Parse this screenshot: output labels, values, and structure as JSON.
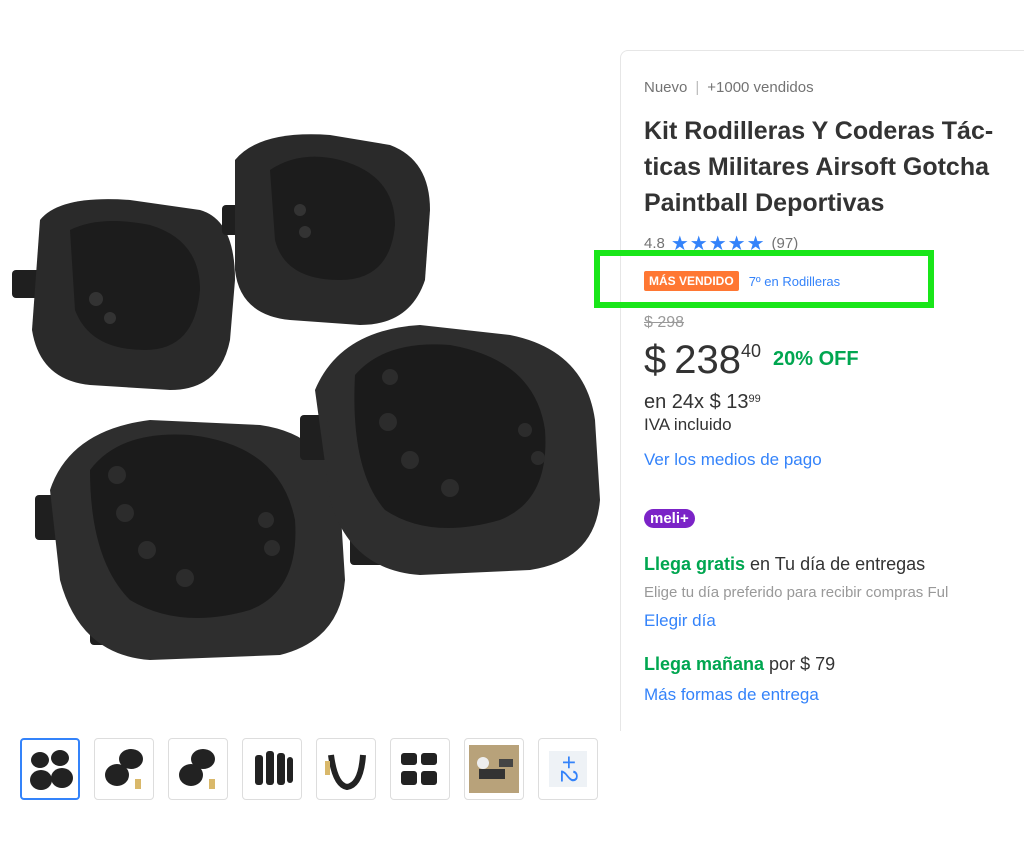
{
  "product": {
    "condition": "Nuevo",
    "sold": "+1000 vendidos",
    "title_line1": "Kit Rodilleras Y Coderas Tác-",
    "title_line2": "ticas Militares Airsoft Gotcha",
    "title_line3": "Paintball Deportivas",
    "rating": "4.8",
    "stars": "★★★★★",
    "reviews": "(97)",
    "badge": "MÁS VENDIDO",
    "rank": "7º en Rodilleras"
  },
  "price": {
    "old": "$ 298",
    "currency": "$",
    "integer": "238",
    "cents": "40",
    "discount": "20% OFF",
    "installments_prefix": "en 24x $ 13",
    "installments_cents": "99",
    "tax": "IVA incluido",
    "payment_link": "Ver los medios de pago"
  },
  "loyalty": {
    "label": "meli+"
  },
  "shipping": {
    "free_label": "Llega gratis",
    "free_rest": " en Tu día de entregas",
    "free_sub": "Elige tu día preferido para recibir compras Ful",
    "choose_link": "Elegir día",
    "tomorrow_label": "Llega mañana",
    "tomorrow_rest": " por $ 79",
    "more_link": "Más formas de entrega"
  },
  "gallery": {
    "more_count": "+2"
  },
  "colors": {
    "accent": "#3483fa",
    "green": "#00a650",
    "badge": "#ff7733",
    "highlight": "#19e619",
    "meli": "#7b23c7"
  }
}
